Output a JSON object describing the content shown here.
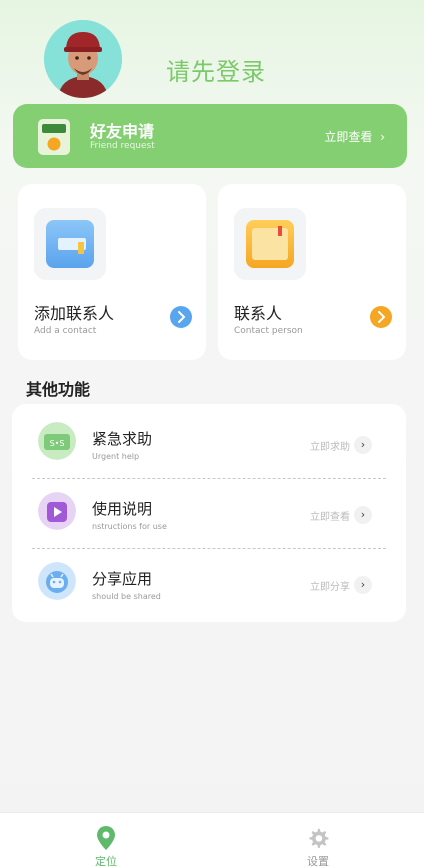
{
  "header": {
    "login_prompt": "请先登录"
  },
  "friend_request": {
    "title": "好友申请",
    "subtitle": "Friend request",
    "link": "立即查看"
  },
  "cards": [
    {
      "title": "添加联系人",
      "subtitle": "Add a contact",
      "arrow_color": "#5aa6ee",
      "icon": "contact-book-blue-icon"
    },
    {
      "title": "联系人",
      "subtitle": "Contact person",
      "arrow_color": "#f5a623",
      "icon": "contact-book-orange-icon"
    }
  ],
  "other": {
    "title": "其他功能",
    "items": [
      {
        "title": "紧急求助",
        "subtitle": "Urgent help",
        "link": "立即求助",
        "icon": "sos-icon"
      },
      {
        "title": "使用说明",
        "subtitle": "nstructions for use",
        "link": "立即查看",
        "icon": "play-icon"
      },
      {
        "title": "分享应用",
        "subtitle": "should be shared",
        "link": "立即分享",
        "icon": "android-icon"
      }
    ]
  },
  "tabs": [
    {
      "label": "定位",
      "icon": "location-pin-icon",
      "active": true
    },
    {
      "label": "设置",
      "icon": "gear-icon",
      "active": false
    }
  ],
  "colors": {
    "brand_green": "#85cf73",
    "active_tab": "#5fb96a",
    "inactive_tab": "#999999"
  }
}
